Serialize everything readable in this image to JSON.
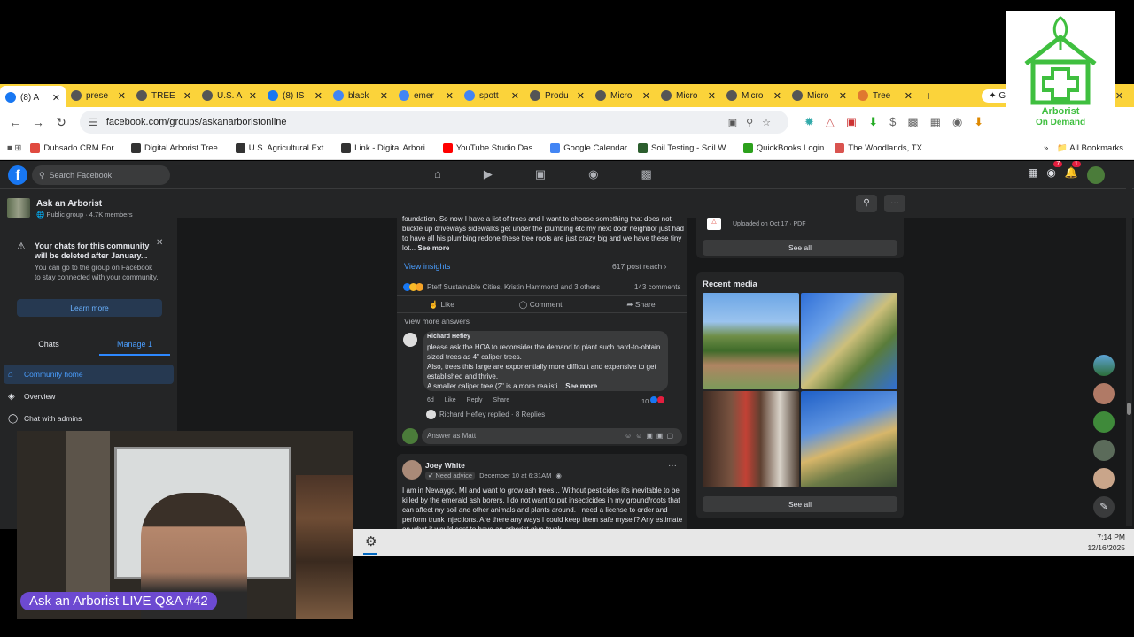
{
  "browser": {
    "tabs": [
      {
        "title": "(8) A",
        "icon": "facebook-icon",
        "color": "#1877f2",
        "active": true
      },
      {
        "title": "prese",
        "icon": "globe-icon",
        "color": "#555555"
      },
      {
        "title": "TREE",
        "icon": "globe-icon",
        "color": "#555555"
      },
      {
        "title": "U.S. A",
        "icon": "globe-icon",
        "color": "#555555"
      },
      {
        "title": "(8) IS",
        "icon": "facebook-icon",
        "color": "#1877f2"
      },
      {
        "title": "black",
        "icon": "google-icon",
        "color": "#4285f4"
      },
      {
        "title": "emer",
        "icon": "google-icon",
        "color": "#4285f4"
      },
      {
        "title": "spott",
        "icon": "google-icon",
        "color": "#4285f4"
      },
      {
        "title": "Produ",
        "icon": "globe-icon",
        "color": "#555555"
      },
      {
        "title": "Micro",
        "icon": "globe-icon",
        "color": "#555555"
      },
      {
        "title": "Micro",
        "icon": "globe-icon",
        "color": "#555555"
      },
      {
        "title": "Micro",
        "icon": "globe-icon",
        "color": "#555555"
      },
      {
        "title": "Micro",
        "icon": "globe-icon",
        "color": "#555555"
      },
      {
        "title": "Tree",
        "icon": "heart-icon",
        "color": "#e0782f"
      }
    ],
    "new_tab_label": "+",
    "gemini_label": "Ge",
    "url": "facebook.com/groups/askanarboristonline",
    "bookmarks": [
      {
        "label": "Dubsado CRM For...",
        "color": "#e04a3f"
      },
      {
        "label": "Digital Arborist Tree...",
        "color": "#333333"
      },
      {
        "label": "U.S. Agricultural Ext...",
        "color": "#333333"
      },
      {
        "label": "Link - Digital Arbori...",
        "color": "#333333"
      },
      {
        "label": "YouTube Studio Das...",
        "color": "#ff0000"
      },
      {
        "label": "Google Calendar",
        "color": "#4285f4"
      },
      {
        "label": "Soil Testing - Soil W...",
        "color": "#2c5e2e"
      },
      {
        "label": "QuickBooks Login",
        "color": "#2ca01c"
      },
      {
        "label": "The Woodlands, TX...",
        "color": "#d9534f"
      }
    ],
    "all_bookmarks_label": "All Bookmarks"
  },
  "facebook": {
    "search_placeholder": "Search Facebook",
    "group": {
      "name": "Ask an Arborist",
      "meta": "Public group · 4.7K members"
    },
    "notice": {
      "title": "Your chats for this community will be deleted after January...",
      "body": "You can go to the group on Facebook to stay connected with your community.",
      "button": "Learn more"
    },
    "tabs": {
      "chats": "Chats",
      "manage": "Manage",
      "manage_count": "1"
    },
    "nav": [
      {
        "label": "Community home",
        "icon": "home-icon"
      },
      {
        "label": "Overview",
        "icon": "layers-icon"
      },
      {
        "label": "Chat with admins",
        "icon": "chat-icon"
      }
    ],
    "notifications_count": "1",
    "messenger_count": "7",
    "post1": {
      "body": "foundation. So now I have a list of trees and I want to choose something that does not buckle up driveways sidewalks get under the plumbing etc my next door neighbor just had to have all his plumbing redone these tree roots are just crazy big and we have these tiny lot...",
      "see_more": "See more",
      "view_insights": "View insights",
      "reach": "617 post reach",
      "reactions": "Pteff Sustainable Cities, Kristin Hammond and 3 others",
      "comments": "143 comments",
      "like": "Like",
      "comment": "Comment",
      "share": "Share",
      "view_more_answers": "View more answers",
      "reply": {
        "author": "Richard Hefley",
        "text1": "please ask the HOA to reconsider the demand to plant such hard-to-obtain sized trees as 4\" caliper trees.",
        "text2": "Also, trees this large are exponentially more difficult and expensive to get established and thrive.",
        "text3": "A smaller caliper tree (2\" is a more realisti...",
        "see_more": "See more",
        "time": "6d",
        "like": "Like",
        "reply": "Reply",
        "share": "Share",
        "reaction_count": "10",
        "replied": "Richard Hefley replied · 8 Replies"
      },
      "answer_placeholder": "Answer as Matt"
    },
    "post2": {
      "author": "Joey White",
      "badge": "Need advice",
      "date": "December 10 at 6:31AM",
      "body": "I am in Newaygo, MI and want to grow ash trees... Without pesticides it's inevitable to be killed by the emerald ash borers. I do not want to put insecticides in my ground/roots that can affect my soil and other animals and plants around. I need a license to order and perform trunk injections. Are there any ways I could keep them safe myself? Any estimate on what it would cost to have an arborist give trunk..."
    },
    "files": {
      "uploaded": "Uploaded on Oct 17 · PDF",
      "see_all": "See all"
    },
    "media": {
      "title": "Recent media",
      "see_all": "See all"
    }
  },
  "taskbar": {
    "time": "7:14 PM",
    "date": "12/16/2025"
  },
  "overlay": {
    "banner": "Ask an Arborist LIVE Q&A #42"
  },
  "logo": {
    "line1": "Arborist",
    "line2": "On Demand"
  }
}
